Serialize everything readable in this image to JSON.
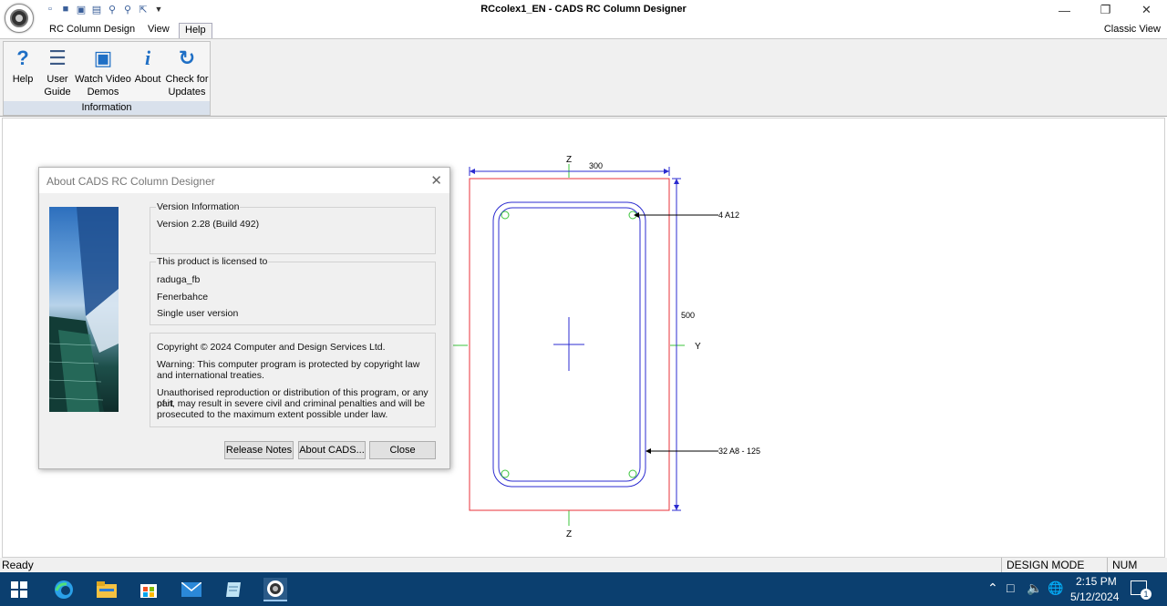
{
  "window": {
    "title": "RCcolex1_EN - CADS RC Column Designer"
  },
  "quick_access": [
    {
      "icon": "new-file-icon"
    },
    {
      "icon": "open-folder-icon"
    },
    {
      "icon": "save-icon"
    },
    {
      "icon": "print-icon"
    },
    {
      "icon": "zoom-icon"
    },
    {
      "icon": "zoom-extents-icon"
    },
    {
      "icon": "select-icon"
    },
    {
      "icon": "customize-arrow-icon"
    }
  ],
  "ribbon": {
    "tabs": [
      "RC Column Design",
      "View",
      "Help"
    ],
    "active_tab": "Help",
    "classic_view": "Classic View",
    "group_label": "Information",
    "buttons": [
      {
        "line1": "Help",
        "line2": "",
        "icon": "help-question-icon",
        "glyph": "?"
      },
      {
        "line1": "User",
        "line2": "Guide",
        "icon": "user-guide-icon",
        "glyph": "☰"
      },
      {
        "line1": "Watch Video",
        "line2": "Demos",
        "icon": "video-camera-icon",
        "glyph": "▣"
      },
      {
        "line1": "About",
        "line2": "",
        "icon": "info-icon",
        "glyph": "i"
      },
      {
        "line1": "Check for",
        "line2": "Updates",
        "icon": "refresh-icon",
        "glyph": "↻"
      }
    ]
  },
  "drawing": {
    "width_dim": "300",
    "height_dim": "500",
    "axis_z_top": "Z",
    "axis_z_bottom": "Z",
    "axis_y": "Y",
    "bars_label": "4 A12",
    "links_label": "32 A8 - 125",
    "colors": {
      "outline": "#e8313a",
      "rebar": "#2b2bd0",
      "axis": "#3cc43c",
      "dim": "#2b2bd0"
    }
  },
  "dialog": {
    "title": "About CADS RC Column Designer",
    "version_legend": "Version Information",
    "version_text": "Version 2.28 (Build 492)",
    "license_legend": "This product is licensed to",
    "license_user": "raduga_fb",
    "license_org": "Fenerbahce",
    "license_type": "Single user version",
    "copyright": "Copyright © 2024 Computer and Design Services Ltd.",
    "warning_1": "Warning: This computer program is protected by copyright law",
    "warning_2": "and international treaties.",
    "unauth_1": "Unauthorised reproduction or distribution of this program, or any part",
    "unauth_2": "of it, may result in severe civil and criminal penalties and will be",
    "unauth_3": "prosecuted to the maximum extent possible under law.",
    "buttons": {
      "release_notes": "Release Notes",
      "about": "About CADS...",
      "close": "Close"
    }
  },
  "status": {
    "ready": "Ready",
    "mode": "DESIGN MODE",
    "num": "NUM"
  },
  "taskbar": {
    "time": "2:15 PM",
    "date": "5/12/2024",
    "notification_count": "1",
    "apps": [
      "start-icon",
      "edge-icon",
      "file-explorer-icon",
      "store-icon",
      "mail-icon",
      "notepad-icon",
      "cads-app-icon"
    ]
  }
}
